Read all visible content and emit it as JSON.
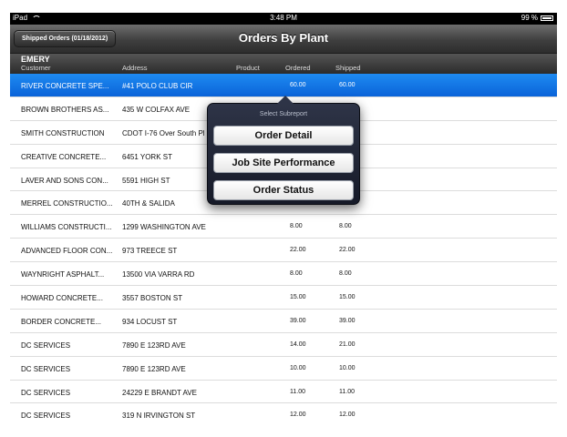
{
  "status_bar": {
    "device": "iPad",
    "time": "3:48 PM",
    "battery": "99 %"
  },
  "nav": {
    "back_label": "Shipped Orders (01/18/2012)",
    "title": "Orders By Plant"
  },
  "section": {
    "plant": "EMERY",
    "columns": {
      "customer": "Customer",
      "address": "Address",
      "product": "Product",
      "ordered": "Ordered",
      "shipped": "Shipped"
    }
  },
  "rows": [
    {
      "customer": "RIVER CONCRETE SPE...",
      "address": "#41 POLO CLUB CIR",
      "ordered": "60.00",
      "shipped": "60.00"
    },
    {
      "customer": "BROWN BROTHERS AS...",
      "address": "435 W COLFAX AVE",
      "ordered": "",
      "shipped": ""
    },
    {
      "customer": "SMITH CONSTRUCTION",
      "address": "CDOT I-76 Over South Pl",
      "ordered": "",
      "shipped": ""
    },
    {
      "customer": "CREATIVE CONCRETE...",
      "address": "6451 YORK ST",
      "ordered": "",
      "shipped": ""
    },
    {
      "customer": "LAVER AND SONS CON...",
      "address": "5591 HIGH ST",
      "ordered": "",
      "shipped": ""
    },
    {
      "customer": "MERREL CONSTRUCTIO...",
      "address": "40TH & SALIDA",
      "ordered": "",
      "shipped": ""
    },
    {
      "customer": "WILLIAMS CONSTRUCTI...",
      "address": "1299 WASHINGTON AVE",
      "ordered": "8.00",
      "shipped": "8.00"
    },
    {
      "customer": "ADVANCED FLOOR CON...",
      "address": "973 TREECE ST",
      "ordered": "22.00",
      "shipped": "22.00"
    },
    {
      "customer": "WAYNRIGHT ASPHALT...",
      "address": "13500 VIA VARRA RD",
      "ordered": "8.00",
      "shipped": "8.00"
    },
    {
      "customer": "HOWARD CONCRETE...",
      "address": "3557 BOSTON ST",
      "ordered": "15.00",
      "shipped": "15.00"
    },
    {
      "customer": "BORDER CONCRETE...",
      "address": "934 LOCUST ST",
      "ordered": "39.00",
      "shipped": "39.00"
    },
    {
      "customer": "DC SERVICES",
      "address": "7890  E 123RD AVE",
      "ordered": "14.00",
      "shipped": "21.00"
    },
    {
      "customer": "DC SERVICES",
      "address": "7890  E 123RD AVE",
      "ordered": "10.00",
      "shipped": "10.00"
    },
    {
      "customer": "DC SERVICES",
      "address": "24229 E BRANDT AVE",
      "ordered": "11.00",
      "shipped": "11.00"
    },
    {
      "customer": "DC SERVICES",
      "address": "319 N IRVINGTON ST",
      "ordered": "12.00",
      "shipped": "12.00"
    }
  ],
  "popover": {
    "title": "Select Subreport",
    "options": [
      "Order Detail",
      "Job Site Performance",
      "Order Status"
    ]
  },
  "colors": {
    "selection": "#1777ea",
    "navbar": "#3f3f3f",
    "popover": "#1e2334"
  }
}
